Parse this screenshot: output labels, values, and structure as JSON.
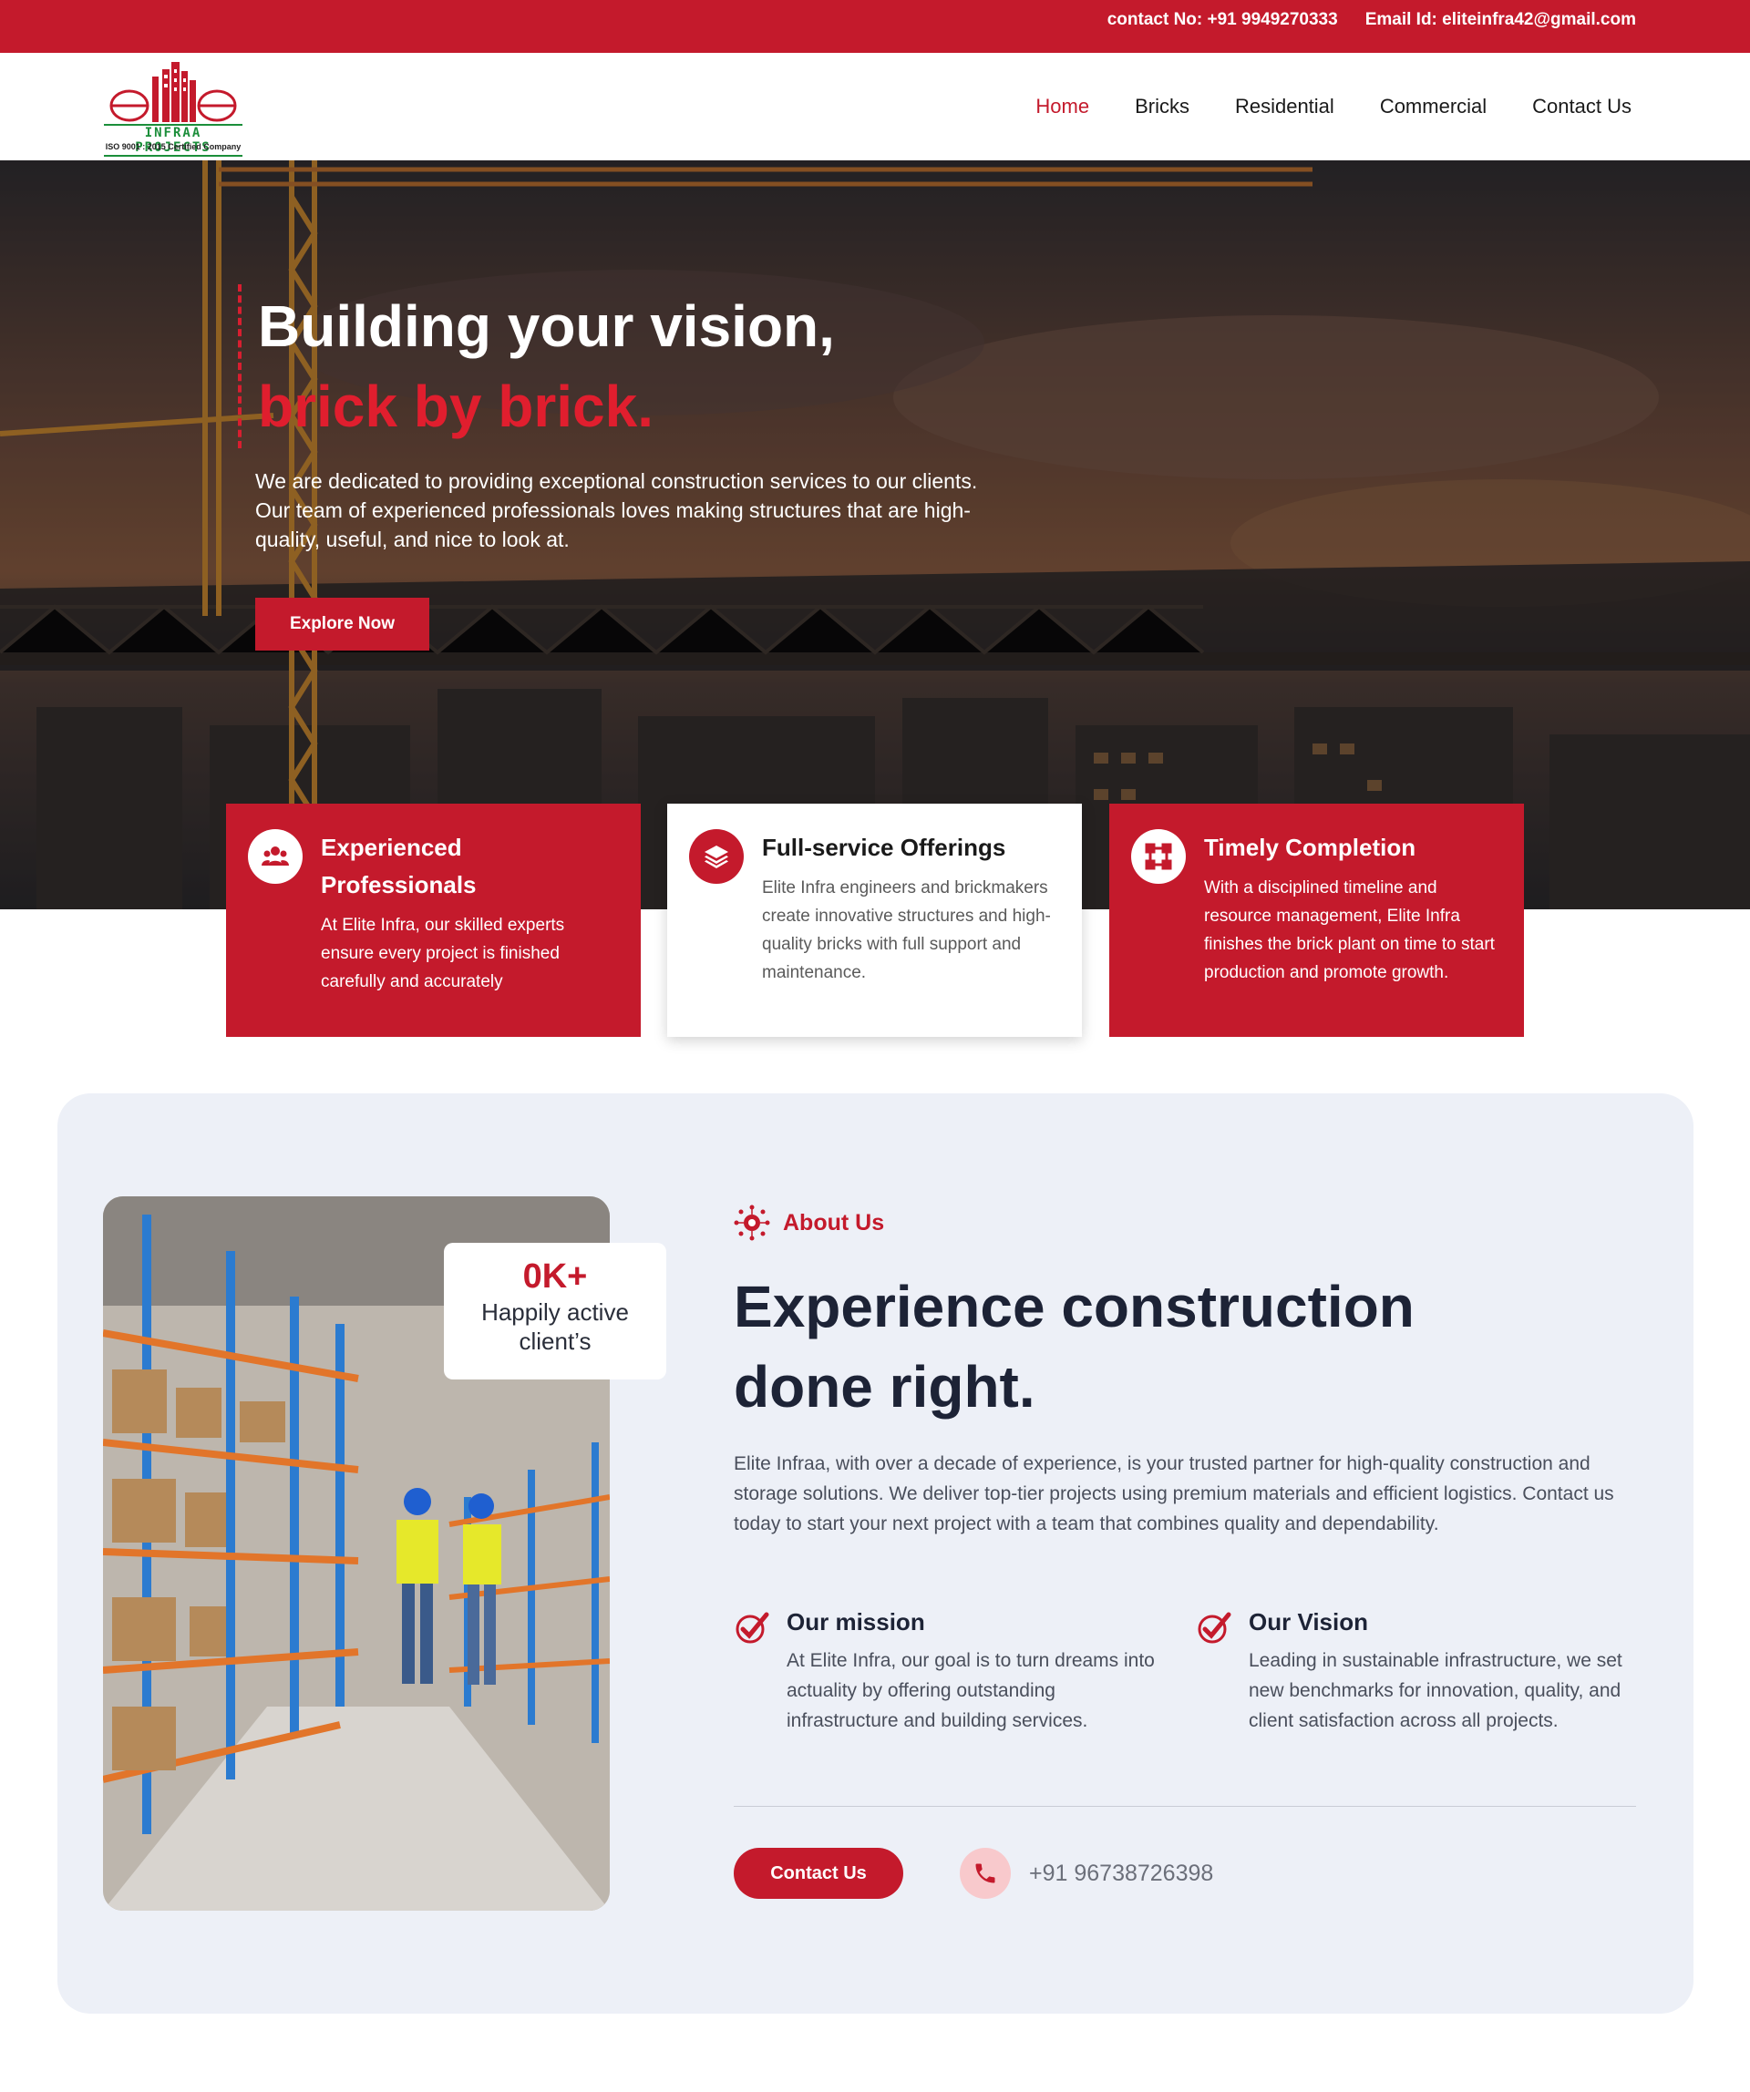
{
  "topbar": {
    "contact": "contact No: +91 9949270333",
    "email": "Email Id: eliteinfra42@gmail.com"
  },
  "logo": {
    "word": "elite",
    "subtitle": "INFRAA PROJECTS",
    "certification": "ISO 9001 : 2015 Certified Company",
    "colors": {
      "brand_red": "#c41a2c",
      "brand_green": "#1b8e3a"
    }
  },
  "nav": {
    "items": [
      {
        "label": "Home",
        "active": true
      },
      {
        "label": "Bricks",
        "active": false
      },
      {
        "label": "Residential",
        "active": false
      },
      {
        "label": "Commercial",
        "active": false
      },
      {
        "label": "Contact Us",
        "active": false
      }
    ]
  },
  "hero": {
    "title_line1": "Building your vision,",
    "title_line2": "brick by brick.",
    "lead": "We are dedicated to providing exceptional construction services to our clients. Our team of experienced professionals loves making structures that are high-quality, useful, and nice to look at.",
    "button": "Explore Now"
  },
  "features": [
    {
      "title": "Experienced Professionals",
      "text": "At Elite Infra, our skilled experts ensure every project is finished carefully and accurately",
      "icon": "team-icon",
      "style": "red"
    },
    {
      "title": "Full-service Offerings",
      "text": "Elite Infra engineers and brickmakers create innovative structures and high-quality bricks with full support and maintenance.",
      "icon": "layers-icon",
      "style": "white"
    },
    {
      "title": "Timely Completion",
      "text": "With a disciplined timeline and resource management, Elite Infra finishes the brick plant on time to start production and promote growth.",
      "icon": "frame-icon",
      "style": "red"
    }
  ],
  "about": {
    "tag": "About Us",
    "heading_line1": "Experience construction",
    "heading_line2": "done right.",
    "description": "Elite Infraa, with over a decade of experience, is your trusted partner for high-quality construction and storage solutions. We deliver top-tier projects using premium materials and efficient logistics. Contact us today to start your next project with a team that combines quality and dependability.",
    "stat_number": "0K+",
    "stat_label": "Happily active client’s",
    "mission_title": "Our mission",
    "mission_text": "At Elite Infra, our goal is to turn dreams into actuality by offering outstanding infrastructure and building services.",
    "vision_title": "Our Vision",
    "vision_text": "Leading in sustainable infrastructure, we set new benchmarks for innovation, quality, and client satisfaction across all projects.",
    "cta": "Contact Us",
    "phone": "+91 96738726398"
  }
}
